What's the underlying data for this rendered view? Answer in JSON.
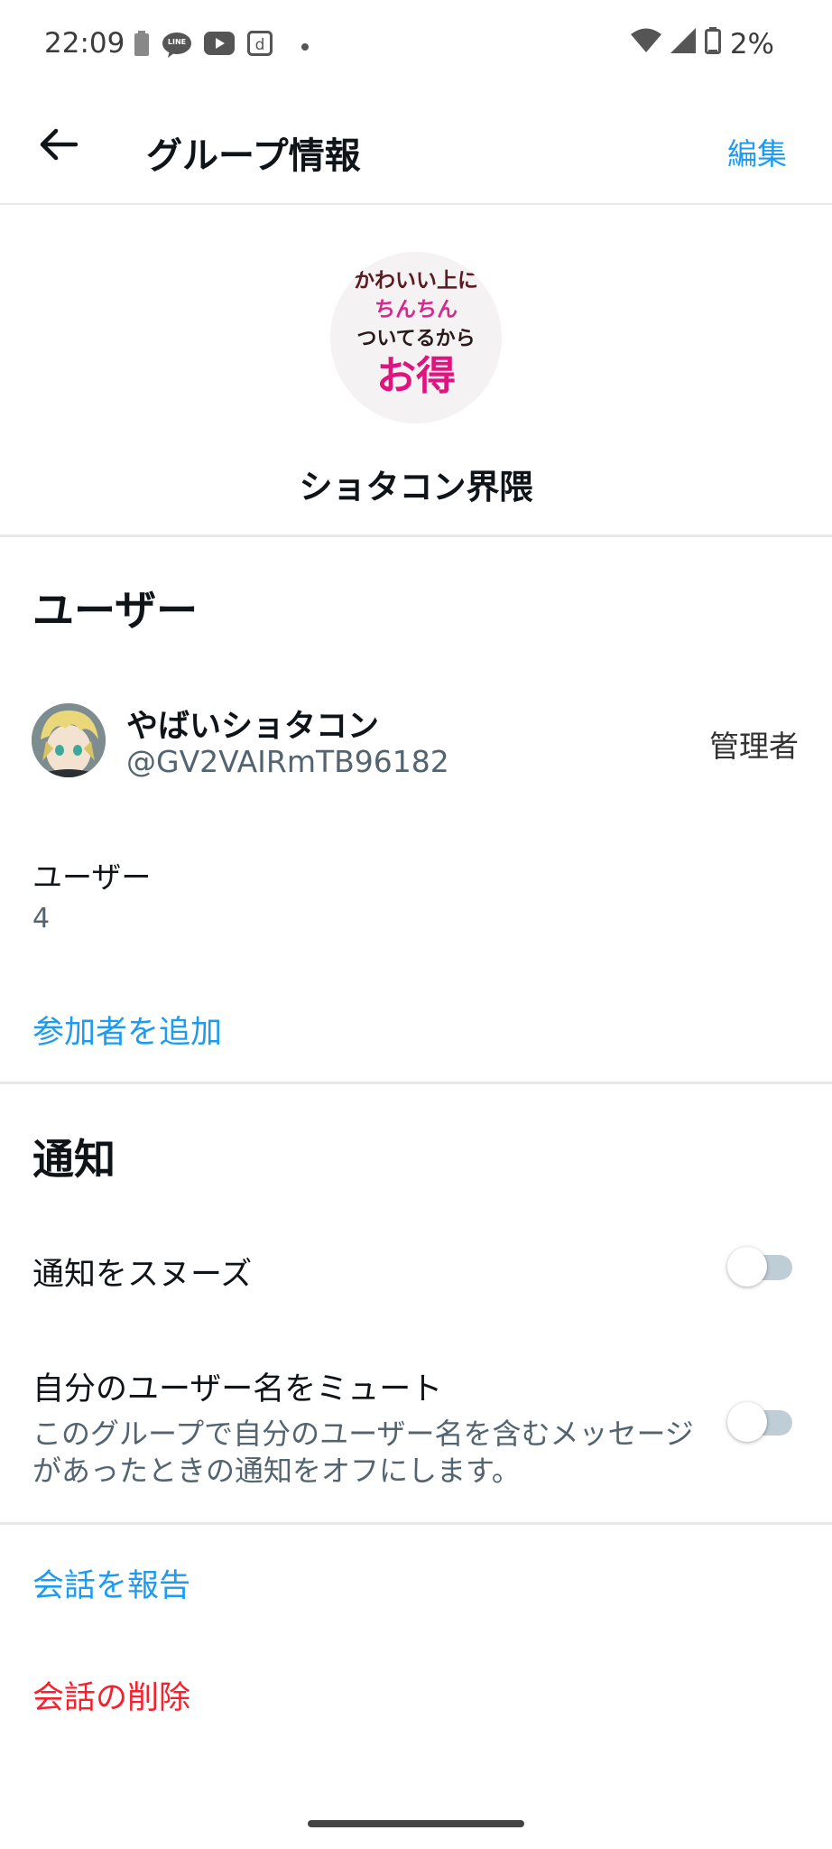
{
  "status_bar": {
    "time": "22:09",
    "battery_percent": "2%",
    "left_icons": [
      "battery-saver-icon",
      "line-app-icon",
      "youtube-icon",
      "d-app-icon",
      "dot-icon"
    ],
    "line_icon_text": "LINE",
    "right_icons": [
      "wifi-icon",
      "cell-signal-icon",
      "battery-icon"
    ]
  },
  "header": {
    "title": "グループ情報",
    "edit_label": "編集",
    "back_icon": "arrow-left-icon"
  },
  "group": {
    "avatar_text": {
      "line1": "かわいい上に",
      "line2": "ちんちん",
      "line3": "ついてるから",
      "line4": "お得"
    },
    "name": "ショタコン界隈"
  },
  "users_section": {
    "title": "ユーザー",
    "members": [
      {
        "name": "やばいショタコン",
        "handle": "@GV2VAIRmTB96182",
        "role": "管理者"
      }
    ],
    "count_label": "ユーザー",
    "count": "4",
    "add_participant_label": "参加者を追加"
  },
  "notifications_section": {
    "title": "通知",
    "snooze": {
      "label": "通知をスヌーズ",
      "enabled": false
    },
    "mute_username": {
      "label": "自分のユーザー名をミュート",
      "description": "このグループで自分のユーザー名を含むメッセージがあったときの通知をオフにします。",
      "enabled": false
    }
  },
  "actions": {
    "report_label": "会話を報告",
    "delete_label": "会話の削除"
  },
  "colors": {
    "link_blue": "#1d9bf0",
    "danger_red": "#f4212e",
    "secondary_text": "#536471",
    "toggle_track_off": "#bfcdd6"
  }
}
